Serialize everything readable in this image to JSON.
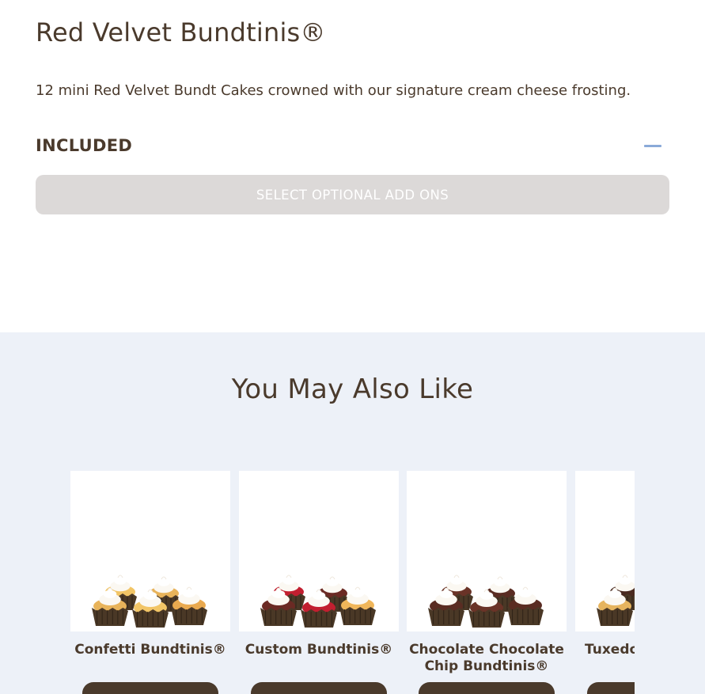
{
  "product": {
    "title": "Red Velvet Bundtinis®",
    "description": "12 mini Red Velvet Bundt Cakes crowned with our signature cream cheese frosting.",
    "included_label": "INCLUDED",
    "addons_button": "SELECT OPTIONAL ADD ONS"
  },
  "recommendations": {
    "heading": "You May Also Like",
    "items": [
      {
        "name": "Confetti Bundtinis®",
        "cake_colors": [
          "#e8b35a",
          "#f2c566",
          "#e9a94f"
        ]
      },
      {
        "name": "Custom Bundtinis®",
        "cake_colors": [
          "#6b2a24",
          "#c21f30",
          "#f0b65a"
        ]
      },
      {
        "name": "Chocolate Chocolate Chip Bundtinis®",
        "cake_colors": [
          "#5a2c22",
          "#6a3327",
          "#5a2c22"
        ]
      },
      {
        "name": "Tuxedo",
        "cake_colors": [
          "#e6b45e",
          "#4a2a20",
          "#e6b45e"
        ]
      }
    ]
  },
  "colors": {
    "text": "#4a3a2c",
    "section_bg": "#edf1f8",
    "addons_bg": "#dcd9d8",
    "accent_blue": "#8aaad8"
  }
}
